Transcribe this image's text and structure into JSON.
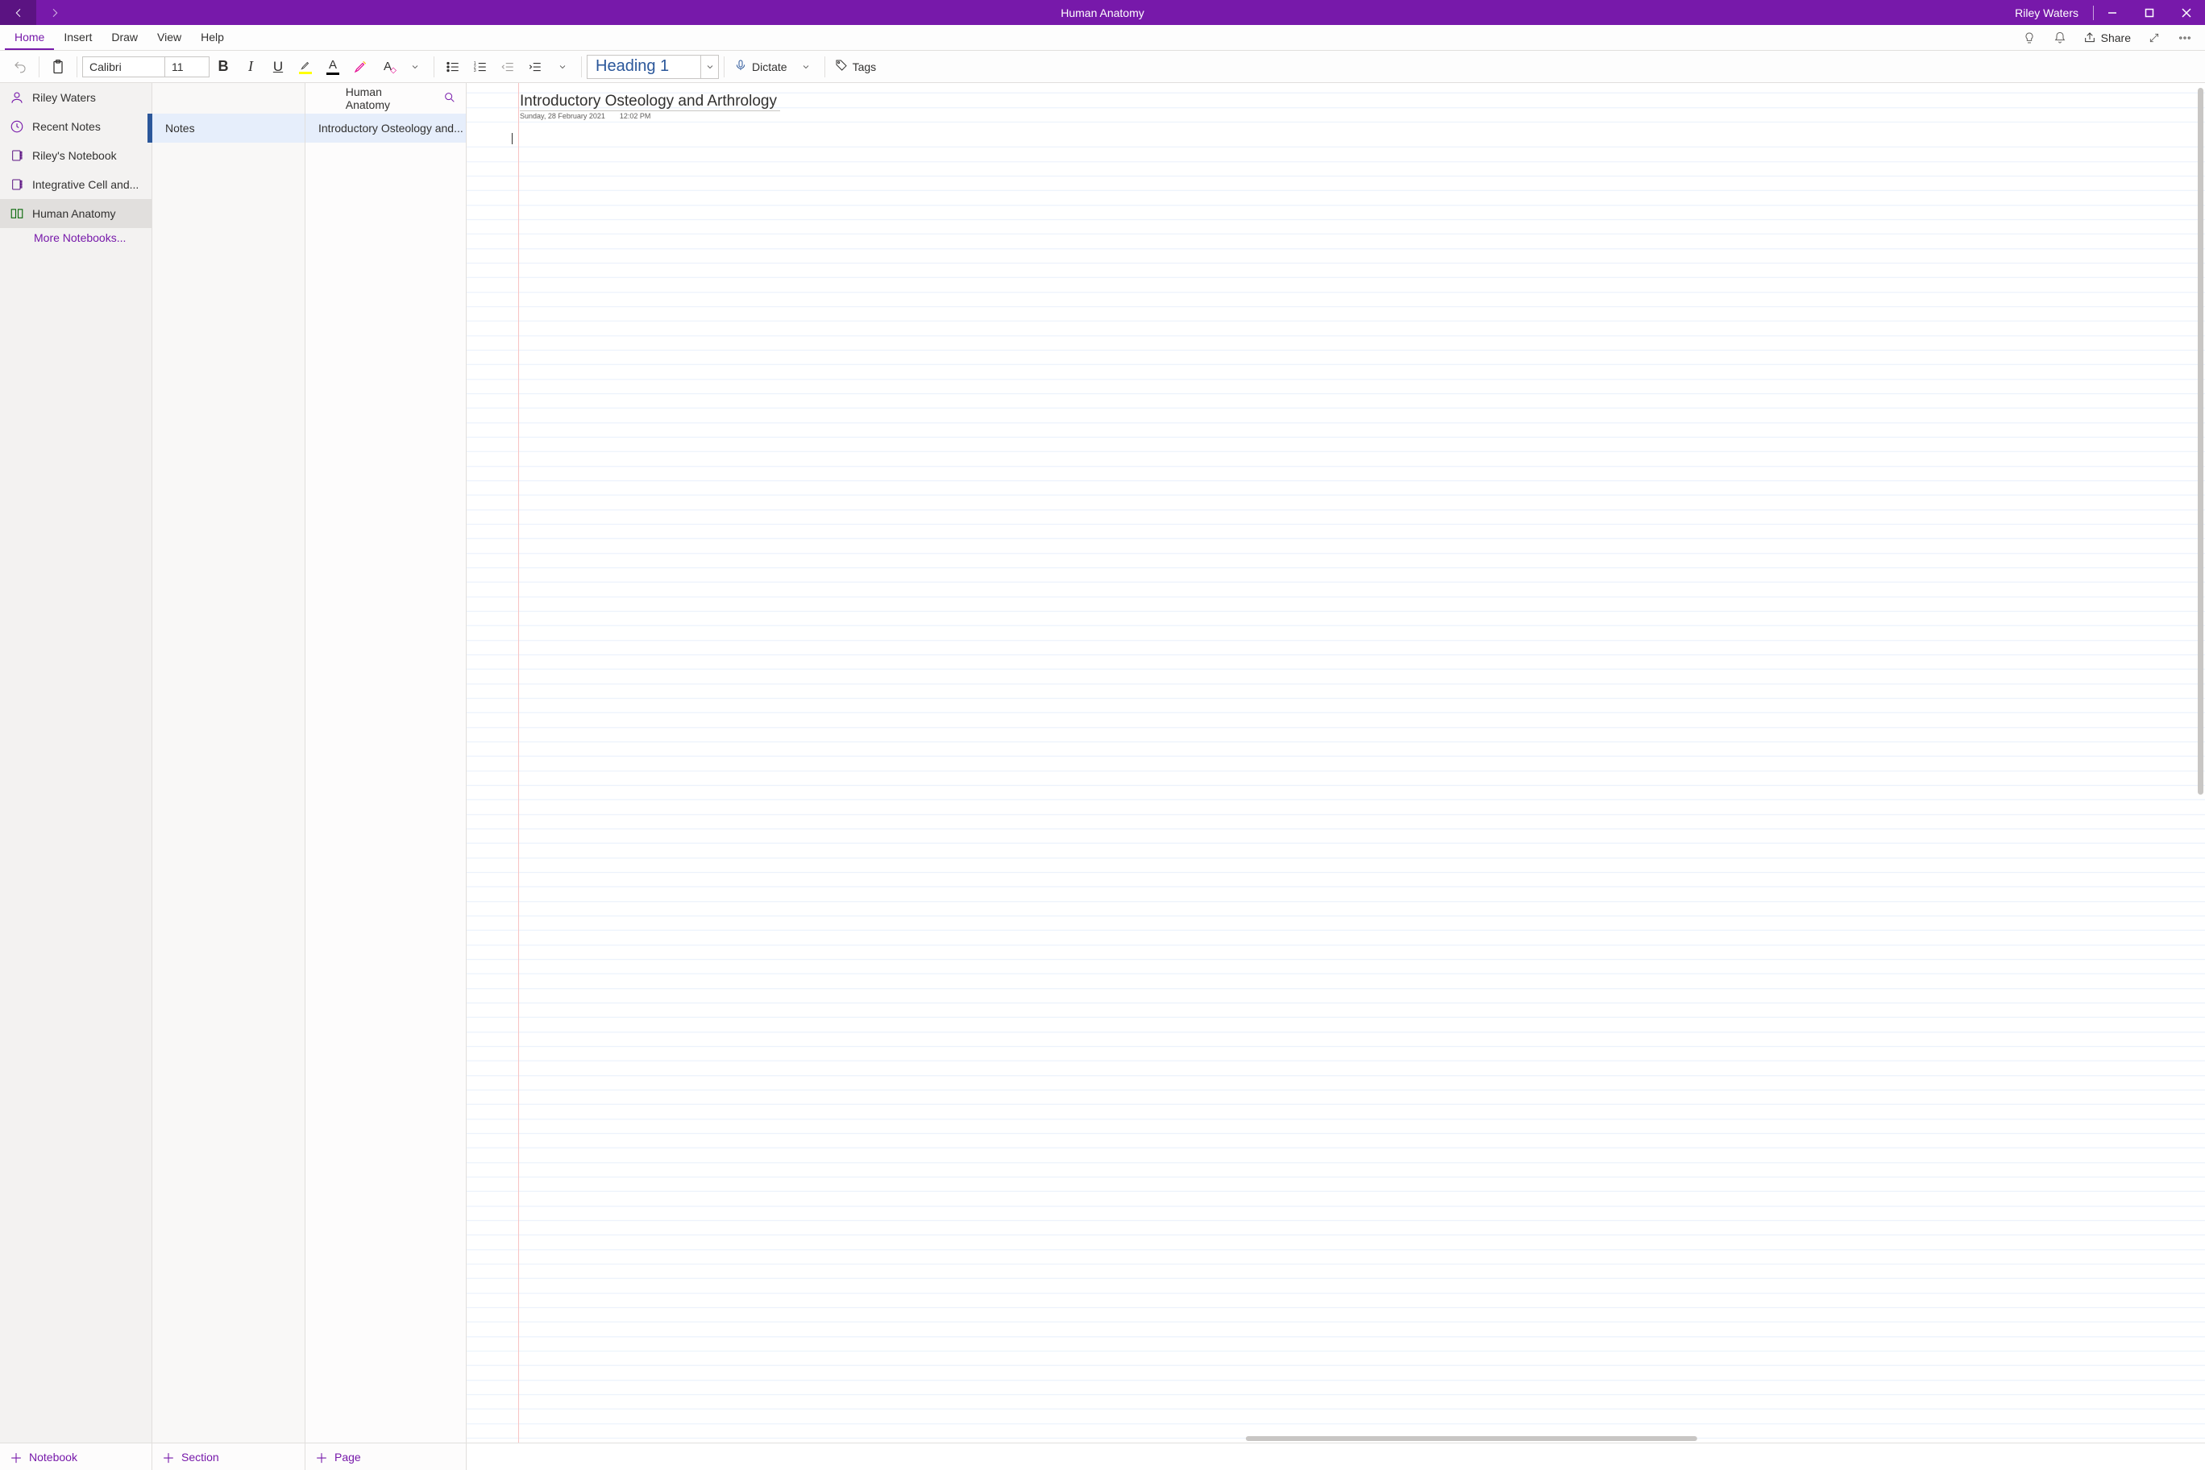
{
  "titlebar": {
    "document_title": "Human Anatomy",
    "user_name": "Riley Waters"
  },
  "tabs": {
    "home": "Home",
    "insert": "Insert",
    "draw": "Draw",
    "view": "View",
    "help": "Help",
    "share": "Share"
  },
  "ribbon": {
    "font_name": "Calibri",
    "font_size": "11",
    "style": "Heading 1",
    "dictate": "Dictate",
    "tags": "Tags"
  },
  "panel1": {
    "user": "Riley Waters",
    "recent": "Recent Notes",
    "nb1": "Riley's Notebook",
    "nb2": "Integrative Cell and...",
    "nb3": "Human Anatomy",
    "more": "More Notebooks..."
  },
  "panel2": {
    "section": "Notes"
  },
  "panel3": {
    "header": "Human Anatomy",
    "page": "Introductory Osteology and..."
  },
  "canvas": {
    "title": "Introductory Osteology and Arthrology",
    "date": "Sunday, 28 February 2021",
    "time": "12:02 PM"
  },
  "bottom": {
    "notebook": "Notebook",
    "section": "Section",
    "page": "Page"
  }
}
